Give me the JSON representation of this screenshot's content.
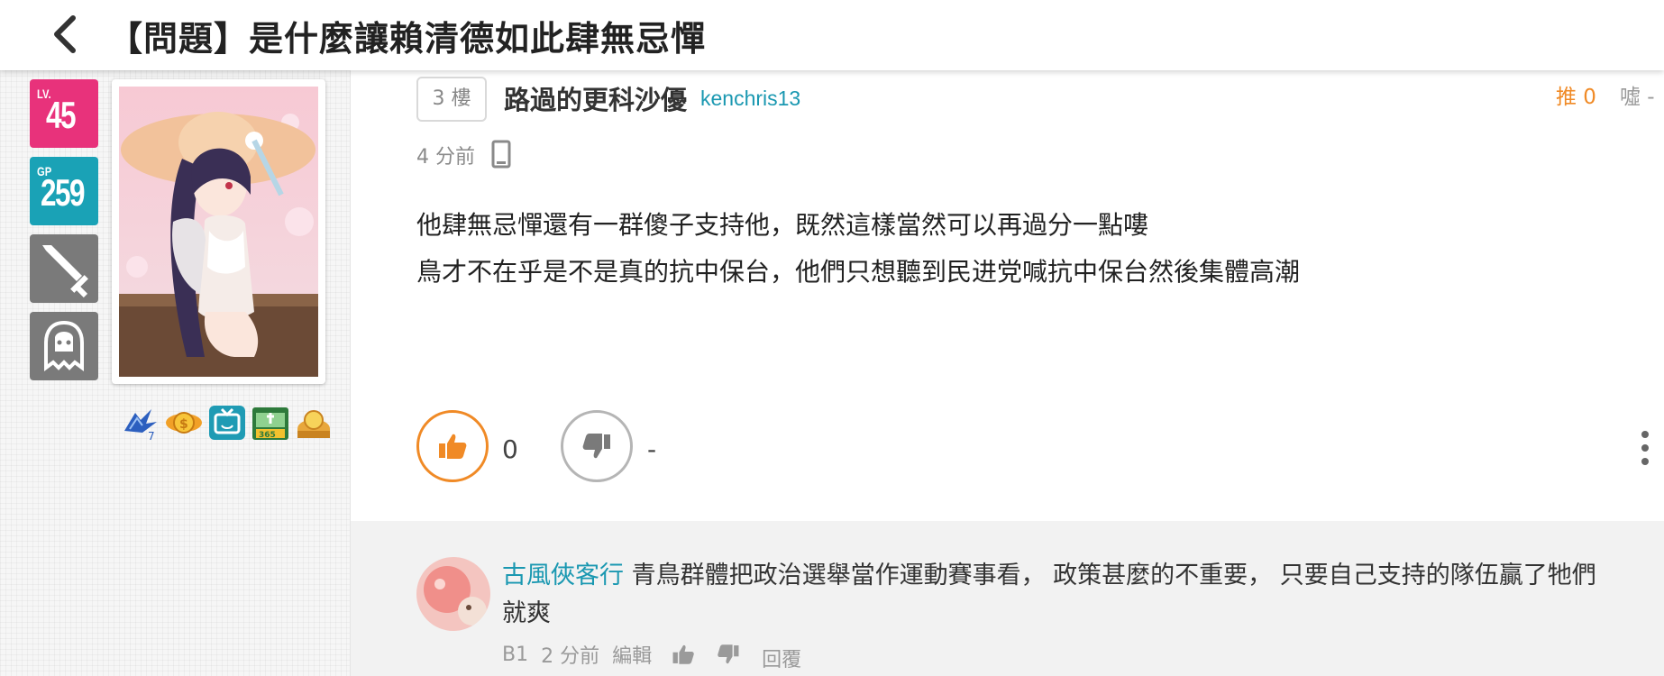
{
  "header": {
    "title": "【問題】是什麼讓賴清德如此肆無忌憚"
  },
  "user_panel": {
    "level_label": "LV.",
    "level": "45",
    "gp_label": "GP",
    "gp": "259",
    "career_icon": "sword-icon",
    "race_icon": "ghost-icon"
  },
  "post": {
    "floor": "3 樓",
    "author_name": "路過的更科沙優",
    "author_id": "kenchris13",
    "push_label": "推 0",
    "boo_label": "噓 -",
    "time": "4 分前",
    "content_lines": [
      "他肆無忌憚還有一群傻子支持他，既然這樣當然可以再過分一點嘍",
      "鳥才不在乎是不是真的抗中保台，他們只想聽到民进党喊抗中保台然後集體高潮"
    ],
    "like_count": "0",
    "dislike_count": "-"
  },
  "comment": {
    "user": "古風俠客行",
    "text": " 青鳥群體把政治選舉當作運動賽事看， 政策甚麼的不重要， 只要自己支持的隊伍贏了牠們就爽",
    "floor": "B1",
    "time": "2 分前",
    "edit_label": "編輯",
    "reply_label": "回覆"
  },
  "colors": {
    "accent_orange": "#f08a26",
    "link_teal": "#1a98b1",
    "level_pink": "#e8327b",
    "gp_teal": "#1aa2b6"
  }
}
